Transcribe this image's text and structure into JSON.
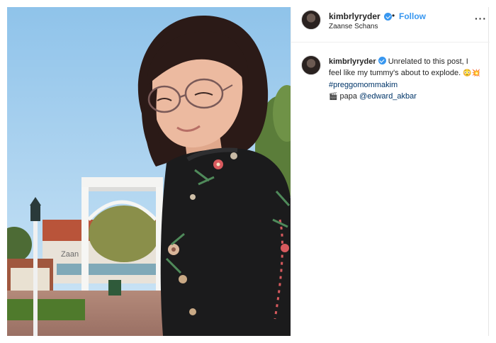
{
  "post": {
    "username": "kimbrlyryder",
    "follow_separator": "•",
    "follow_label": "Follow",
    "location": "Zaanse Schans",
    "more_label": "···"
  },
  "caption": {
    "username": "kimbrlyryder",
    "text": "Unrelated to this post, I feel like my tummy's about to explode.",
    "emoji_1": "😳",
    "emoji_2": "💥",
    "hashtag": "#preggomommakim",
    "credit_icon": "🎬",
    "credit_text": "papa",
    "mention": "@edward_akbar"
  },
  "photo": {
    "sign_text": "Zaan"
  },
  "colors": {
    "accent": "#3897f0",
    "link": "#003569"
  }
}
